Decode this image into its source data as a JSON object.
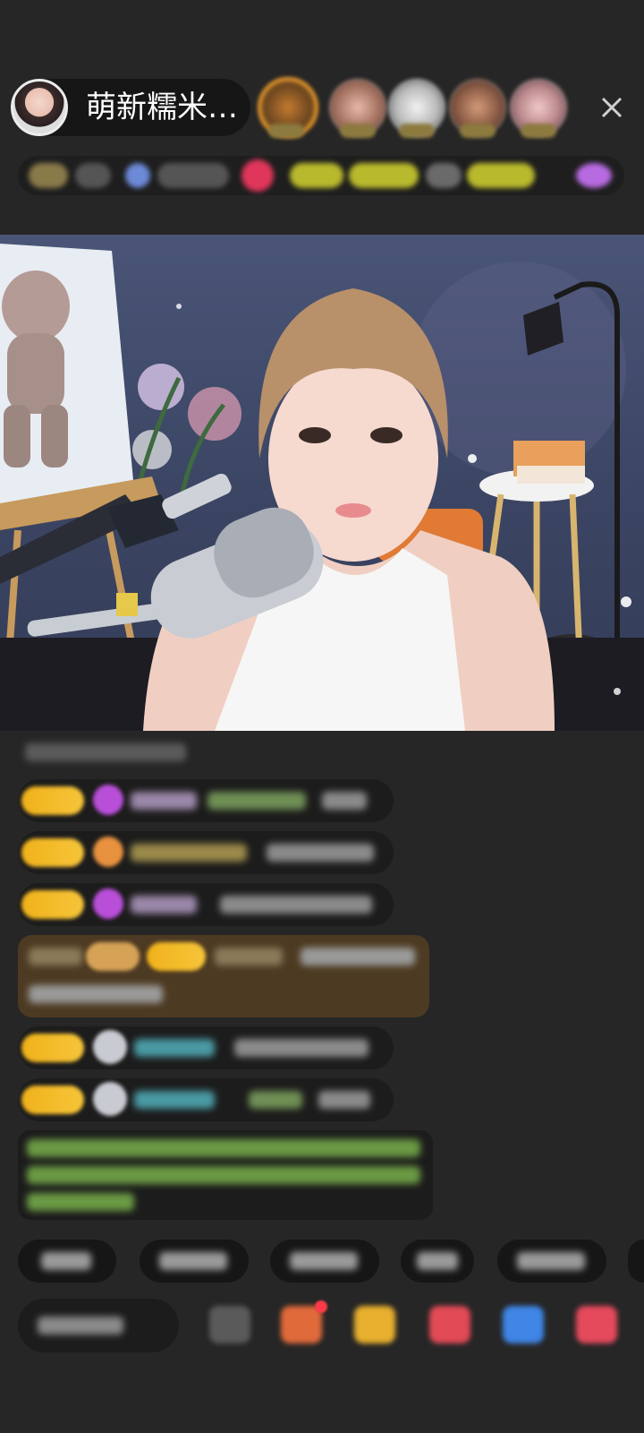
{
  "header": {
    "host_name": "萌新糯米…",
    "close_icon": "close-icon"
  },
  "colors": {
    "background": "#262626",
    "level_badge": "#f0b21b",
    "highlight_message_bg": "#4d3a22",
    "system_text": "#7fc24f"
  }
}
